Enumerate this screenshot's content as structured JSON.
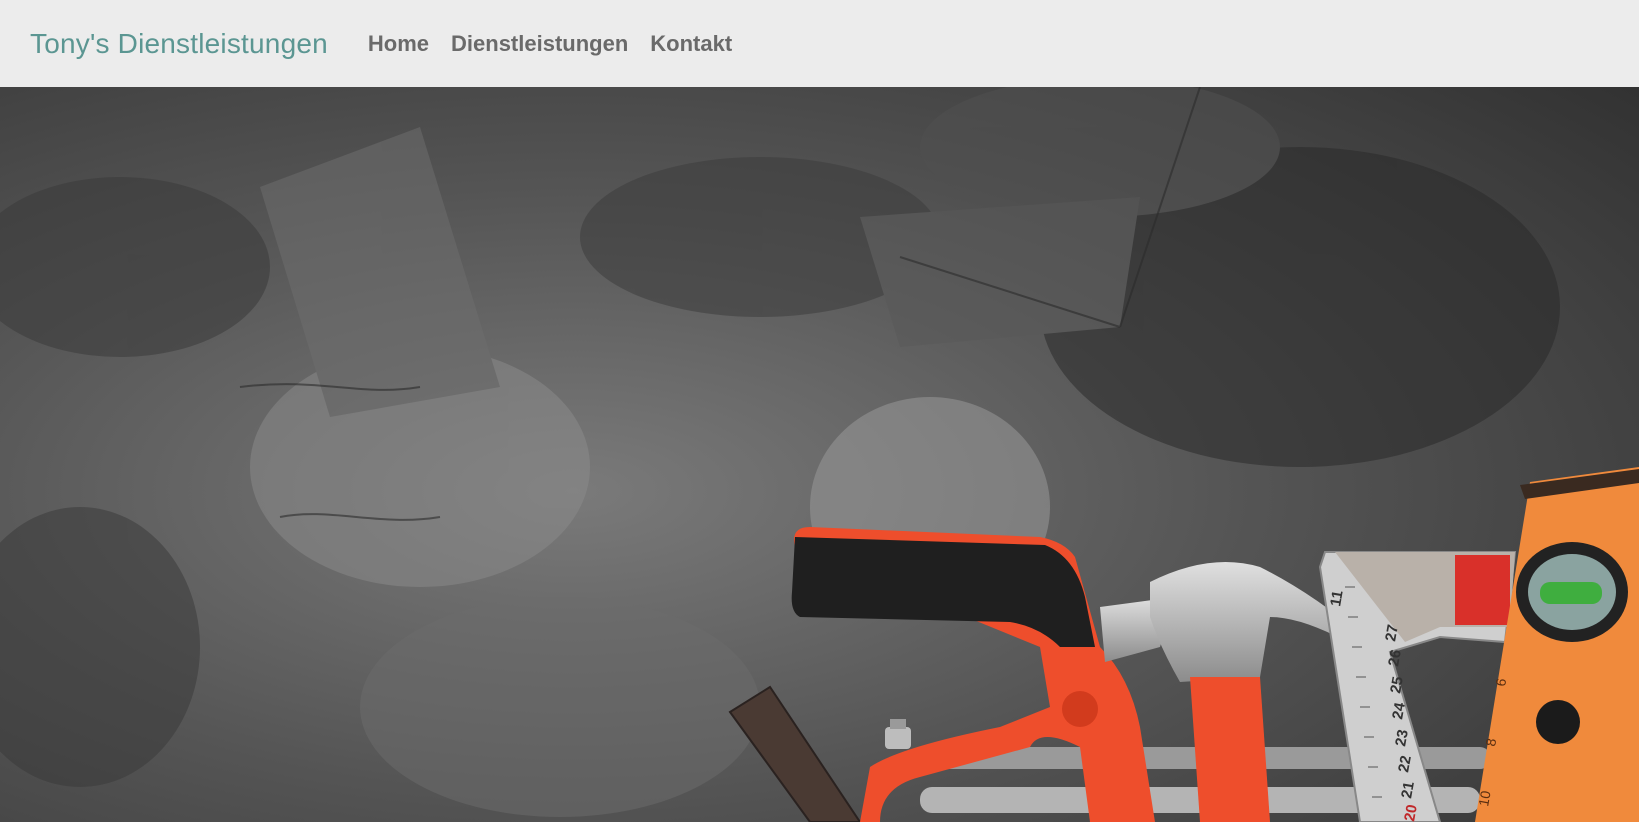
{
  "navbar": {
    "brand": "Tony's Dienstleistungen",
    "links": [
      {
        "label": "Home"
      },
      {
        "label": "Dienstleistungen"
      },
      {
        "label": "Kontakt"
      }
    ]
  },
  "colors": {
    "brand": "#5b9692",
    "nav_link": "#6a6a6a",
    "navbar_bg": "#ececec",
    "tool_orange": "#ee4e2c",
    "level_orange": "#f08a3c"
  },
  "hero": {
    "image": "tools-on-dark-concrete-wall",
    "ruler_ticks": [
      "11",
      "27",
      "26",
      "25",
      "24",
      "23",
      "22",
      "21",
      "20"
    ],
    "level_ticks": [
      "6",
      "8",
      "10"
    ]
  }
}
